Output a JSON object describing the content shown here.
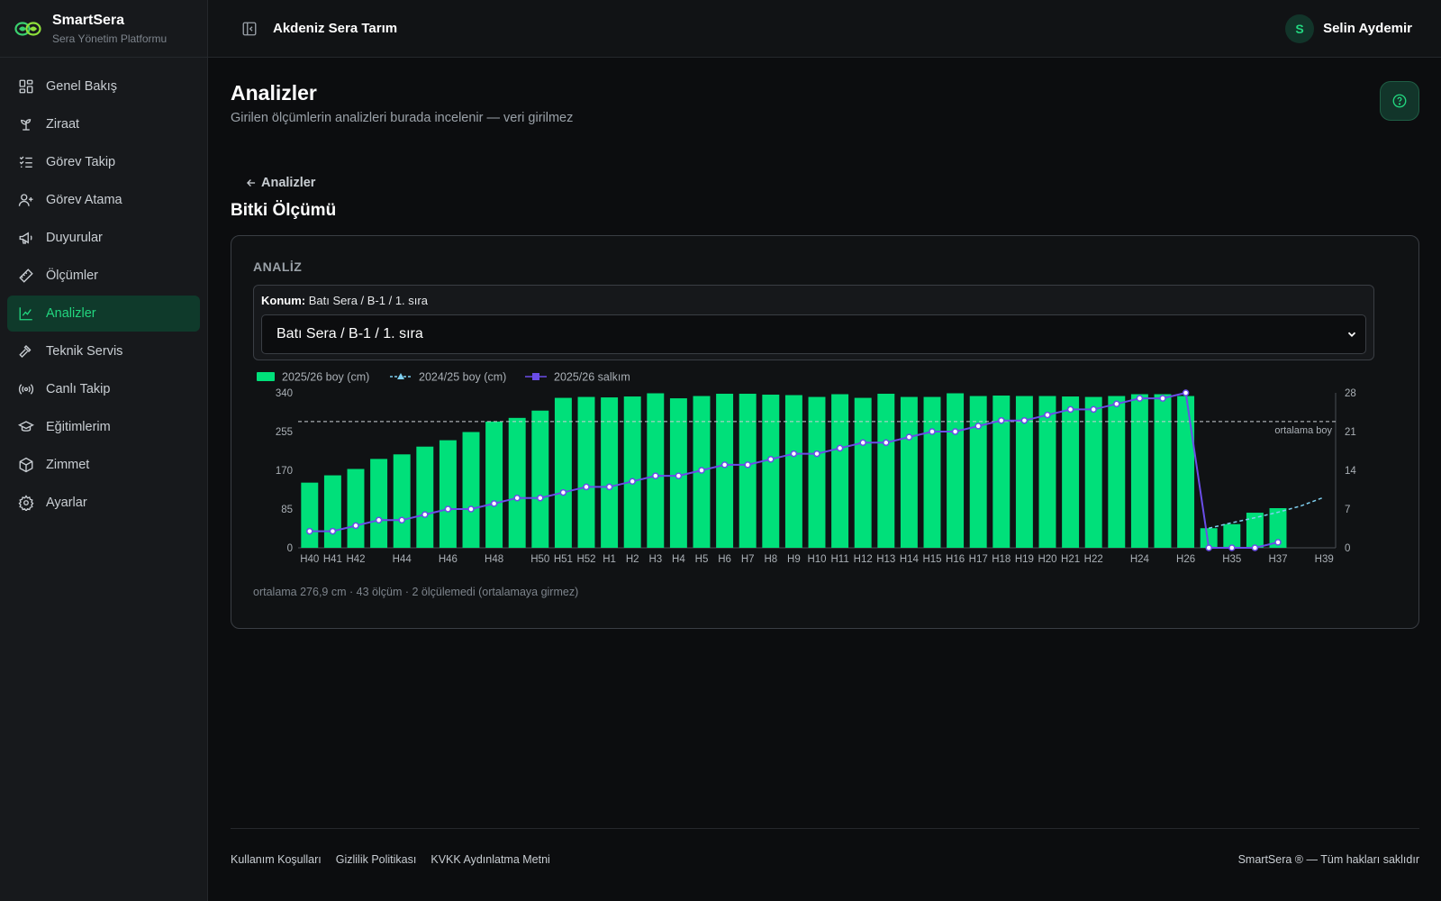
{
  "brand": {
    "name": "SmartSera",
    "subtitle": "Sera Yönetim Platformu"
  },
  "sidebar": {
    "items": [
      {
        "label": "Genel Bakış",
        "icon": "dashboard-icon"
      },
      {
        "label": "Ziraat",
        "icon": "sprout-icon"
      },
      {
        "label": "Görev Takip",
        "icon": "checklist-icon"
      },
      {
        "label": "Görev Atama",
        "icon": "user-plus-icon"
      },
      {
        "label": "Duyurular",
        "icon": "megaphone-icon"
      },
      {
        "label": "Ölçümler",
        "icon": "ruler-icon"
      },
      {
        "label": "Analizler",
        "icon": "chart-line-icon",
        "active": true
      },
      {
        "label": "Teknik Servis",
        "icon": "hammer-icon"
      },
      {
        "label": "Canlı Takip",
        "icon": "broadcast-icon"
      },
      {
        "label": "Eğitimlerim",
        "icon": "graduation-cap-icon"
      },
      {
        "label": "Zimmet",
        "icon": "box-icon"
      },
      {
        "label": "Ayarlar",
        "icon": "gear-icon"
      }
    ]
  },
  "topbar": {
    "org": "Akdeniz Sera Tarım",
    "user_initial": "S",
    "user_name": "Selin Aydemir"
  },
  "page": {
    "title": "Analizler",
    "subtitle": "Girilen ölçümlerin analizleri burada incelenir — veri girilmez",
    "back_label": "Analizler",
    "section_title": "Bitki Ölçümü"
  },
  "card": {
    "label": "ANALİZ",
    "location_caption_label": "Konum:",
    "location_caption_value": "Batı Sera / B-1 / 1. sıra",
    "location_selected": "Batı Sera / B-1 / 1. sıra",
    "footnote": "ortalama 276,9 cm · 43 ölçüm · 2 ölçülemedi (ortalamaya girmez)"
  },
  "colors": {
    "accent": "#22d67f",
    "bar": "#00e07a",
    "line_salkim": "#6a4de8",
    "line_prev": "#7fd0f0",
    "bg": "#0c0d0f"
  },
  "chart_data": {
    "type": "bar",
    "categories": [
      "H40",
      "H41",
      "H42",
      "H43",
      "H44",
      "H45",
      "H46",
      "H47",
      "H48",
      "H49",
      "H50",
      "H51",
      "H52",
      "H1",
      "H2",
      "H3",
      "H4",
      "H5",
      "H6",
      "H7",
      "H8",
      "H9",
      "H10",
      "H11",
      "H12",
      "H13",
      "H14",
      "H15",
      "H16",
      "H17",
      "H18",
      "H19",
      "H20",
      "H21",
      "H22",
      "H23",
      "H24",
      "H25",
      "H26",
      "H34",
      "H35",
      "H36",
      "H37",
      "H38",
      "H39"
    ],
    "tick_labels": [
      "H40",
      "H41",
      "H42",
      "",
      "H44",
      "",
      "H46",
      "",
      "H48",
      "",
      "H50",
      "H51",
      "H52",
      "H1",
      "H2",
      "H3",
      "H4",
      "H5",
      "H6",
      "H7",
      "H8",
      "H9",
      "H10",
      "H11",
      "H12",
      "H13",
      "H14",
      "H15",
      "H16",
      "H17",
      "H18",
      "H19",
      "H20",
      "H21",
      "H22",
      "",
      "H24",
      "",
      "H26",
      "",
      "H35",
      "",
      "H37",
      "",
      "H39"
    ],
    "series": [
      {
        "name": "2025/26 boy (cm)",
        "kind": "bar",
        "axis": "left",
        "values": [
          143,
          159,
          173,
          195,
          205,
          222,
          236,
          254,
          277,
          285,
          301,
          329,
          331,
          330,
          332,
          339,
          328,
          333,
          338,
          338,
          336,
          335,
          331,
          337,
          329,
          338,
          331,
          331,
          339,
          333,
          334,
          333,
          333,
          332,
          331,
          333,
          337,
          337,
          333,
          43,
          52,
          77,
          87,
          null,
          null
        ]
      },
      {
        "name": "2024/25 boy (cm)",
        "kind": "line-dashed",
        "axis": "left",
        "points": [
          [
            39,
            43
          ],
          [
            40,
            55
          ],
          [
            41,
            66
          ],
          [
            42,
            78
          ],
          [
            43,
            92
          ],
          [
            44,
            111
          ]
        ]
      },
      {
        "name": "2025/26 salkım",
        "kind": "line",
        "axis": "right",
        "values": [
          3,
          3,
          4,
          5,
          5,
          6,
          7,
          7,
          8,
          9,
          9,
          10,
          11,
          11,
          12,
          13,
          13,
          14,
          15,
          15,
          16,
          17,
          17,
          18,
          19,
          19,
          20,
          21,
          21,
          22,
          23,
          23,
          24,
          25,
          25,
          26,
          27,
          27,
          28,
          0,
          0,
          0,
          1,
          null,
          null
        ]
      }
    ],
    "reference_line": {
      "value": 276.9,
      "label": "ortalama boy",
      "axis": "left"
    },
    "ylim_left": [
      0,
      340
    ],
    "yticks_left": [
      0,
      85,
      170,
      255,
      340
    ],
    "ylim_right": [
      0,
      28
    ],
    "yticks_right": [
      0,
      7,
      14,
      21,
      28
    ],
    "legend_placement": "top-left"
  },
  "footer": {
    "links": [
      "Kullanım Koşulları",
      "Gizlilik Politikası",
      "KVKK Aydınlatma Metni"
    ],
    "copyright": "SmartSera ® — Tüm hakları saklıdır"
  }
}
